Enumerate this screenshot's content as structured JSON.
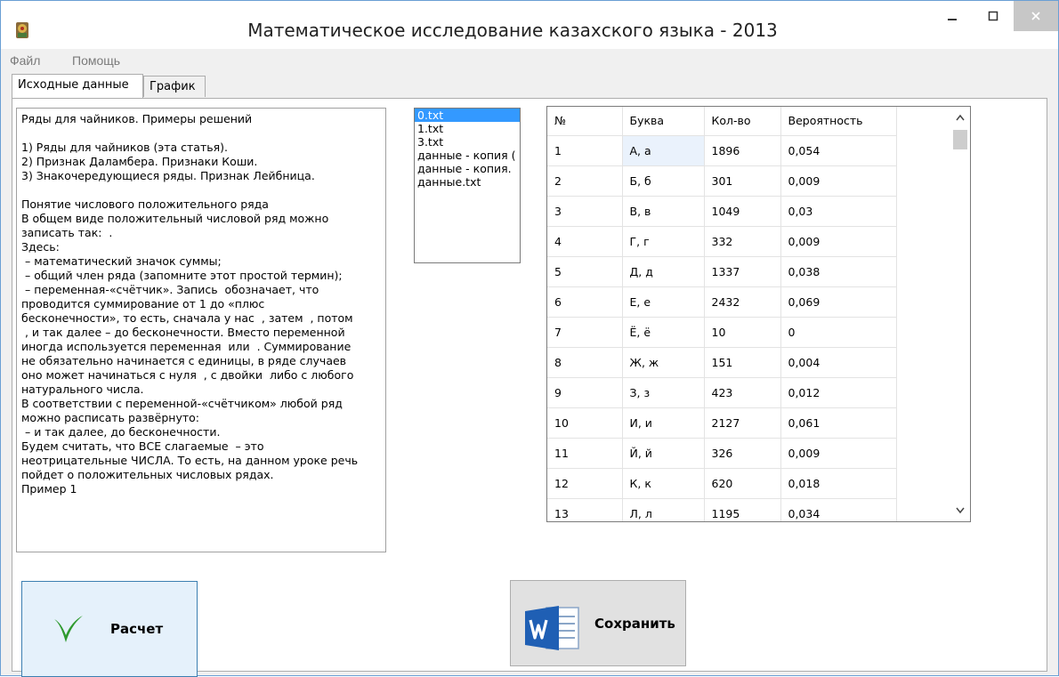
{
  "window": {
    "title": "Математическое исследование казахского языка  -  2013"
  },
  "menu": {
    "file": "Файл",
    "help": "Помощь"
  },
  "tabs": {
    "source": "Исходные данные",
    "chart": "График"
  },
  "text_lines": [
    "Ряды для чайников. Примеры решений",
    "",
    "1) Ряды для чайников (эта статья).",
    "2) Признак Даламбера. Признаки Коши.",
    "3) Знакочередующиеся ряды. Признак Лейбница.",
    "",
    "Понятие числового положительного ряда",
    "В общем виде положительный числовой ряд можно",
    "записать так:  .",
    "Здесь:",
    " – математический значок суммы;",
    " – общий член ряда (запомните этот простой термин);",
    " – переменная-«счётчик». Запись  обозначает, что",
    "проводится суммирование от 1 до «плюс",
    "бесконечности», то есть, сначала у нас  , затем  , потом",
    " , и так далее – до бесконечности. Вместо переменной",
    "иногда используется переменная  или  . Суммирование",
    "не обязательно начинается с единицы, в ряде случаев",
    "оно может начинаться с нуля  , с двойки  либо с любого",
    "натурального числа.",
    "В соответствии с переменной-«счётчиком» любой ряд",
    "можно расписать развёрнуто:",
    " – и так далее, до бесконечности.",
    "Будем считать, что ВСЕ слагаемые  – это",
    "неотрицательные ЧИСЛА. То есть, на данном уроке речь",
    "пойдет о положительных числовых рядах.",
    "Пример 1"
  ],
  "files": [
    "0.txt",
    "1.txt",
    "3.txt",
    "данные - копия (",
    "данные - копия.",
    "данные.txt"
  ],
  "table": {
    "headers": [
      "№",
      "Буква",
      "Кол-во",
      "Вероятность"
    ],
    "rows": [
      [
        "1",
        "А, а",
        "1896",
        "0,054"
      ],
      [
        "2",
        "Б, б",
        "301",
        "0,009"
      ],
      [
        "3",
        "В, в",
        "1049",
        "0,03"
      ],
      [
        "4",
        "Г, г",
        "332",
        "0,009"
      ],
      [
        "5",
        "Д, д",
        "1337",
        "0,038"
      ],
      [
        "6",
        "Е, е",
        "2432",
        "0,069"
      ],
      [
        "7",
        "Ё, ё",
        "10",
        "0"
      ],
      [
        "8",
        "Ж, ж",
        "151",
        "0,004"
      ],
      [
        "9",
        "З, з",
        "423",
        "0,012"
      ],
      [
        "10",
        "И, и",
        "2127",
        "0,061"
      ],
      [
        "11",
        "Й, й",
        "326",
        "0,009"
      ],
      [
        "12",
        "К, к",
        "620",
        "0,018"
      ],
      [
        "13",
        "Л, л",
        "1195",
        "0,034"
      ]
    ]
  },
  "buttons": {
    "calculate": "Расчет",
    "save": "Сохранить"
  }
}
